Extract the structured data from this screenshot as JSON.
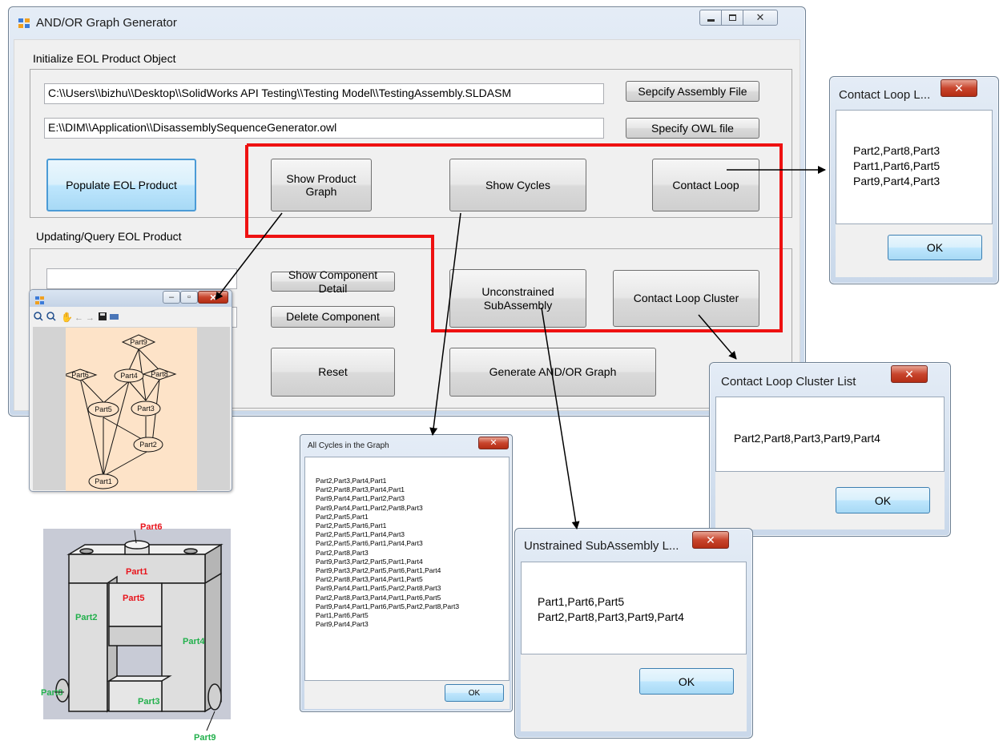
{
  "main_window": {
    "title": "AND/OR Graph Generator",
    "group1_title": "Initialize EOL Product Object",
    "assembly_path": "C:\\\\Users\\\\bizhu\\\\Desktop\\\\SolidWorks API Testing\\\\Testing Model\\\\TestingAssembly.SLDASM",
    "owl_path": "E:\\\\DIM\\\\Application\\\\DisassemblySequenceGenerator.owl",
    "specify_assembly_button": "Sepcify Assembly File",
    "specify_owl_button": "Specify OWL file",
    "populate_button": "Populate EOL Product",
    "show_product_graph_button": "Show Product Graph",
    "show_cycles_button": "Show Cycles",
    "contact_loop_button": "Contact Loop",
    "group2_title": "Updating/Query EOL Product",
    "show_component_detail_button": "Show Component Detail",
    "delete_component_button": "Delete Component",
    "unconstrained_button": "Unconstrained SubAssembly",
    "contact_loop_cluster_button": "Contact Loop Cluster",
    "reset_button": "Reset",
    "generate_button": "Generate AND/OR Graph"
  },
  "contact_loop_dialog": {
    "title": "Contact Loop L...",
    "lines": [
      "Part2,Part8,Part3",
      "Part1,Part6,Part5",
      "Part9,Part4,Part3"
    ],
    "ok": "OK"
  },
  "cluster_dialog": {
    "title": "Contact Loop Cluster List",
    "lines": [
      "Part2,Part8,Part3,Part9,Part4"
    ],
    "ok": "OK"
  },
  "cycles_dialog": {
    "title": "All Cycles in the Graph",
    "lines": [
      "Part2,Part3,Part4,Part1",
      "Part2,Part8,Part3,Part4,Part1",
      "Part9,Part4,Part1,Part2,Part3",
      "Part9,Part4,Part1,Part2,Part8,Part3",
      "Part2,Part5,Part1",
      "Part2,Part5,Part6,Part1",
      "Part2,Part5,Part1,Part4,Part3",
      "Part2,Part5,Part6,Part1,Part4,Part3",
      "Part2,Part8,Part3",
      "Part9,Part3,Part2,Part5,Part1,Part4",
      "Part9,Part3,Part2,Part5,Part6,Part1,Part4",
      "Part2,Part8,Part3,Part4,Part1,Part5",
      "Part9,Part4,Part1,Part5,Part2,Part8,Part3",
      "Part2,Part8,Part3,Part4,Part1,Part6,Part5",
      "Part9,Part4,Part1,Part6,Part5,Part2,Part8,Part3",
      "Part1,Part6,Part5",
      "Part9,Part4,Part3"
    ],
    "ok": "OK"
  },
  "subassembly_dialog": {
    "title": "Unstrained SubAssembly L...",
    "lines": [
      "Part1,Part6,Part5",
      "Part2,Part8,Part3,Part9,Part4"
    ],
    "ok": "OK"
  },
  "graph_window": {
    "nodes": {
      "part9": "Part9",
      "part6": "Part6",
      "part4": "Part4",
      "part8": "Part8",
      "part5": "Part5",
      "part3": "Part3",
      "part2": "Part2",
      "part1": "Part1"
    }
  },
  "assembly_image": {
    "labels": {
      "part6": "Part6",
      "part1": "Part1",
      "part5": "Part5",
      "part2": "Part2",
      "part4": "Part4",
      "part8": "Part8",
      "part3": "Part3",
      "part9": "Part9"
    }
  },
  "colors": {
    "highlight_frame": "#ee1111",
    "focus_blue": "#4b9bd6",
    "graph_bg": "#fde3c8",
    "part_red": "#e8141c",
    "part_green": "#22b04c",
    "close_red": "#c8452d"
  }
}
